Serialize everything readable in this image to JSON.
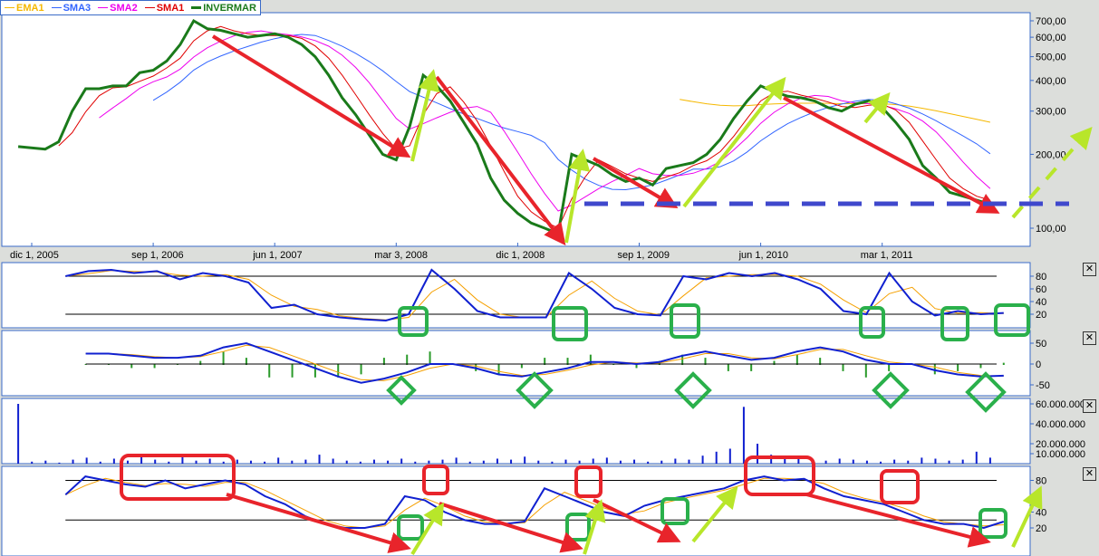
{
  "legend": [
    {
      "label": "EMA1",
      "color": "#f5b800"
    },
    {
      "label": "SMA3",
      "color": "#3366ff"
    },
    {
      "label": "SMA2",
      "color": "#ee00ee"
    },
    {
      "label": "SMA1",
      "color": "#e00000"
    },
    {
      "label": "INVERMAR",
      "color": "#1a7a1a"
    }
  ],
  "chart_data": [
    {
      "type": "line",
      "title": "INVERMAR",
      "scale": "log",
      "y_ticks": [
        "700,00",
        "600,00",
        "500,00",
        "400,00",
        "300,00",
        "200,00",
        "100,00"
      ],
      "y_tick_values": [
        700,
        600,
        500,
        400,
        300,
        200,
        100
      ],
      "x_ticks": [
        "dic 1, 2005",
        "sep 1, 2006",
        "jun 1, 2007",
        "mar 3, 2008",
        "dic 1, 2008",
        "sep 1, 2009",
        "jun 1, 2010",
        "mar 1, 2011"
      ],
      "x_tick_months": [
        0,
        9,
        18,
        27,
        36,
        45,
        54,
        63
      ],
      "x_months": [
        -1,
        1,
        2,
        3,
        4,
        5,
        6,
        7,
        8,
        9,
        10,
        11,
        12,
        13,
        14,
        15,
        16,
        17,
        18,
        19,
        20,
        21,
        22,
        23,
        24,
        25,
        26,
        27,
        28,
        29,
        30,
        31,
        32,
        33,
        34,
        35,
        36,
        37,
        38,
        39,
        40,
        41,
        42,
        43,
        44,
        45,
        46,
        47,
        48,
        49,
        50,
        51,
        52,
        53,
        54,
        55,
        56,
        57,
        58,
        59,
        60,
        61,
        62,
        63,
        64,
        65,
        66,
        67,
        68,
        69,
        70,
        71
      ],
      "price": [
        215,
        210,
        225,
        300,
        370,
        370,
        380,
        380,
        430,
        440,
        480,
        560,
        700,
        650,
        640,
        620,
        600,
        610,
        620,
        600,
        560,
        500,
        420,
        340,
        290,
        240,
        200,
        190,
        260,
        420,
        380,
        330,
        270,
        220,
        160,
        130,
        115,
        105,
        100,
        95,
        200,
        190,
        180,
        165,
        155,
        160,
        150,
        175,
        180,
        185,
        200,
        230,
        280,
        330,
        380,
        360,
        345,
        340,
        330,
        310,
        300,
        320,
        330,
        310,
        270,
        230,
        180,
        160,
        140,
        135,
        130,
        125
      ],
      "series_names": [
        "EMA1",
        "SMA3",
        "SMA2",
        "SMA1",
        "INVERMAR"
      ],
      "support_level": 125
    },
    {
      "type": "line",
      "name": "oscillator-1",
      "y_ticks": [
        "80",
        "60",
        "40",
        "20"
      ],
      "y_tick_values": [
        80,
        60,
        40,
        20
      ],
      "values": [
        80,
        88,
        90,
        85,
        88,
        75,
        85,
        80,
        70,
        30,
        35,
        20,
        15,
        12,
        10,
        20,
        90,
        60,
        25,
        15,
        15,
        15,
        85,
        60,
        30,
        20,
        18,
        80,
        75,
        85,
        80,
        85,
        75,
        60,
        25,
        20,
        85,
        40,
        18,
        25,
        20,
        22
      ]
    },
    {
      "type": "line",
      "name": "macd",
      "y_ticks": [
        "50",
        "0",
        "-50"
      ],
      "y_tick_values": [
        50,
        0,
        -50
      ],
      "values": [
        25,
        25,
        20,
        15,
        15,
        20,
        40,
        50,
        30,
        10,
        -10,
        -30,
        -45,
        -35,
        -20,
        0,
        0,
        -10,
        -25,
        -30,
        -20,
        -10,
        5,
        5,
        0,
        5,
        20,
        30,
        20,
        10,
        15,
        30,
        40,
        30,
        10,
        0,
        0,
        -15,
        -25,
        -30,
        -28
      ]
    },
    {
      "type": "bar",
      "name": "volume",
      "y_ticks": [
        "60.000.000",
        "40.000.000",
        "20.000.000",
        "10.000.000"
      ],
      "y_tick_values": [
        60,
        40,
        20,
        10
      ],
      "values_millions": [
        60,
        2,
        3,
        1,
        4,
        6,
        2,
        5,
        3,
        7,
        4,
        2,
        8,
        3,
        5,
        2,
        4,
        3,
        2,
        6,
        3,
        4,
        9,
        5,
        3,
        2,
        4,
        3,
        5,
        2,
        3,
        4,
        6,
        2,
        3,
        5,
        4,
        7,
        3,
        2,
        4,
        3,
        5,
        6,
        3,
        4,
        2,
        3,
        5,
        4,
        8,
        12,
        15,
        57,
        20,
        9,
        6,
        5,
        4,
        3,
        5,
        4,
        3,
        2,
        4,
        3,
        6,
        5,
        3,
        4,
        12,
        6
      ]
    },
    {
      "type": "line",
      "name": "oscillator-4",
      "y_ticks": [
        "80",
        "40",
        "20"
      ],
      "y_tick_values": [
        80,
        40,
        20
      ],
      "values": [
        62,
        85,
        80,
        75,
        72,
        80,
        70,
        75,
        80,
        75,
        60,
        50,
        35,
        25,
        20,
        20,
        25,
        60,
        55,
        40,
        30,
        25,
        25,
        28,
        70,
        60,
        50,
        40,
        35,
        48,
        55,
        60,
        65,
        70,
        80,
        85,
        80,
        82,
        70,
        60,
        55,
        50,
        40,
        30,
        25,
        25,
        20,
        28
      ]
    }
  ],
  "close_label": "✕"
}
